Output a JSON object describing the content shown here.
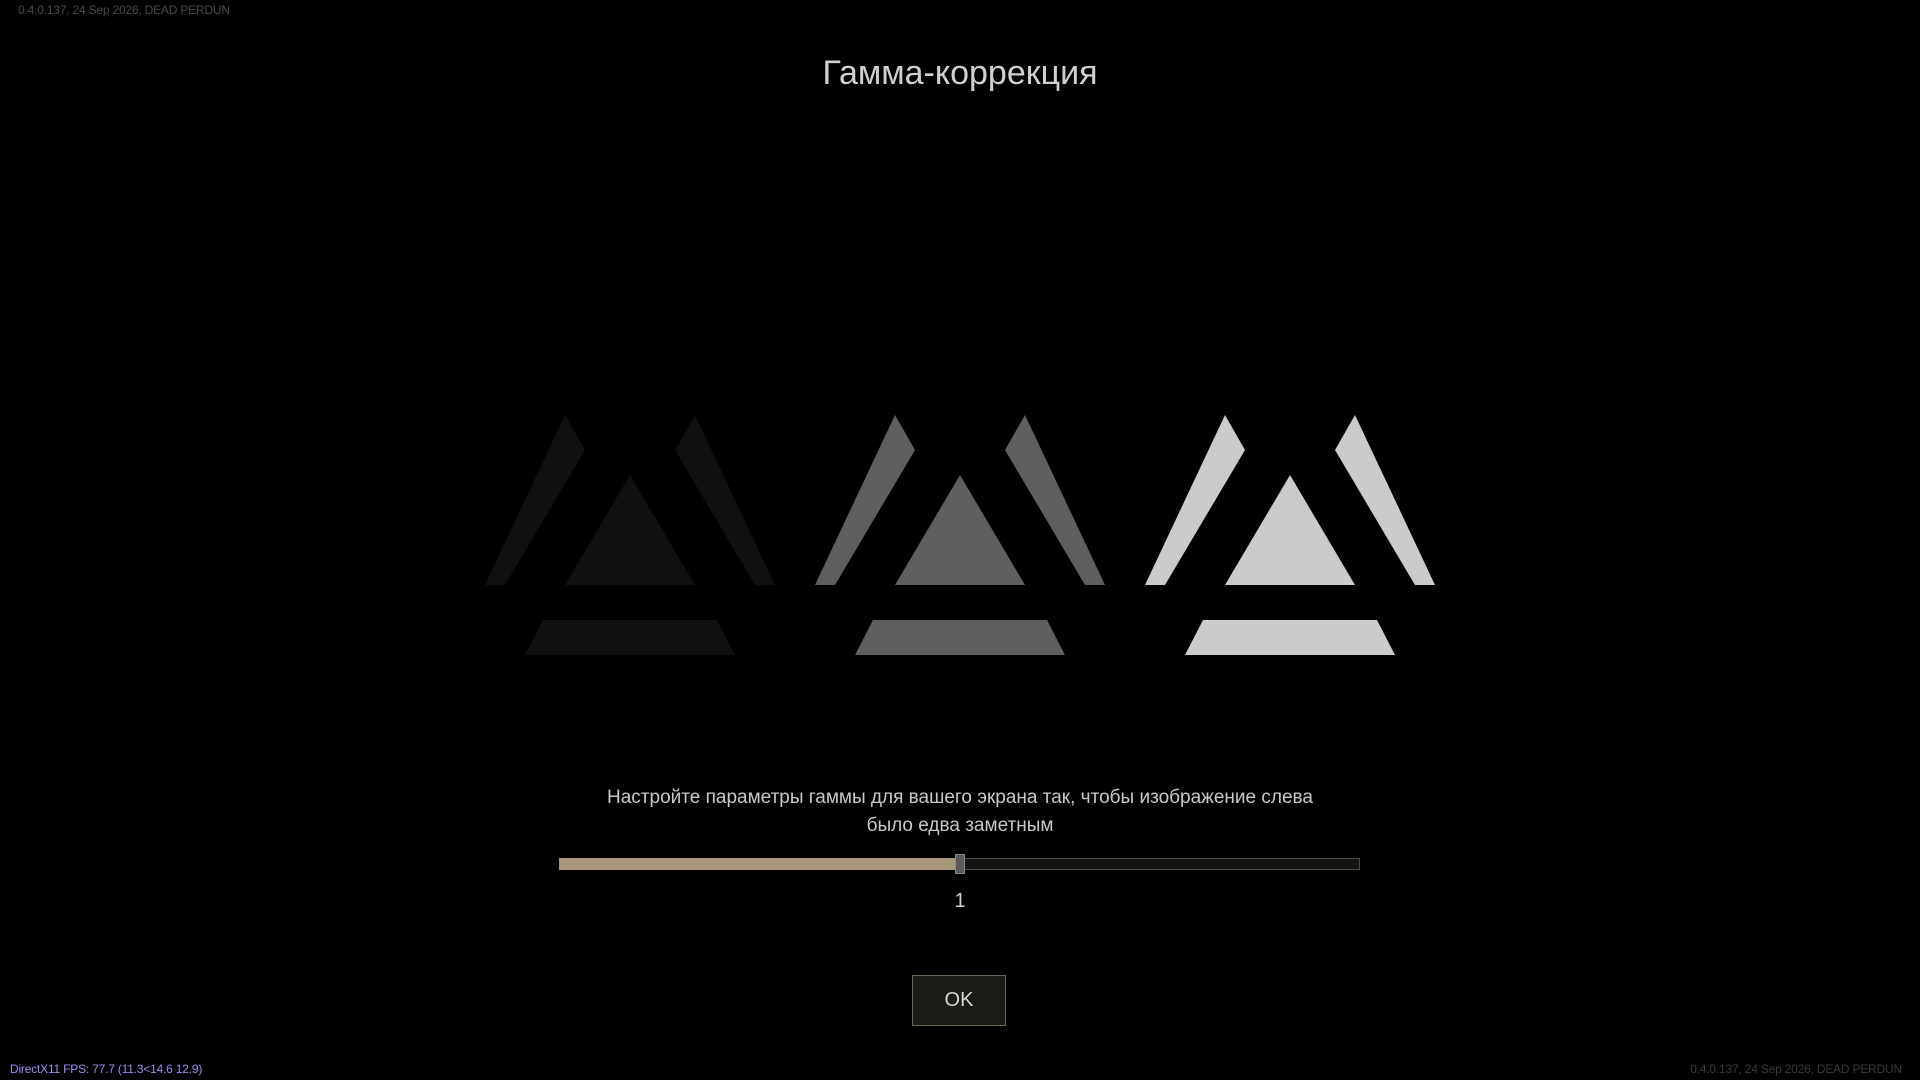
{
  "build_info_top": "0.4.0.137, 24 Sep 2026, DEAD PERDUN",
  "build_info_bottom": "0.4.0.137, 24 Sep 2026, DEAD PERDUN",
  "fps_overlay": "DirectX11 FPS: 77.7 (11.3<14.6 12.9)",
  "dialog": {
    "title": "Гамма-коррекция",
    "instructions_line1": "Настройте параметры гаммы для вашего экрана так, чтобы изображение слева",
    "instructions_line2": "было едва заметным",
    "ok_label": "OK"
  },
  "gamma_slider": {
    "value_label": "1",
    "fill_fraction": 0.5
  },
  "calibration_emblems": [
    {
      "name": "dark",
      "color": "#101010"
    },
    {
      "name": "mid",
      "color": "#5f5f5f"
    },
    {
      "name": "light",
      "color": "#cbcbcb"
    }
  ],
  "colors": {
    "background": "#000000",
    "slider_fill": "#a9987a",
    "fps_text": "#9b8cf0",
    "button_border": "#6c6858"
  }
}
